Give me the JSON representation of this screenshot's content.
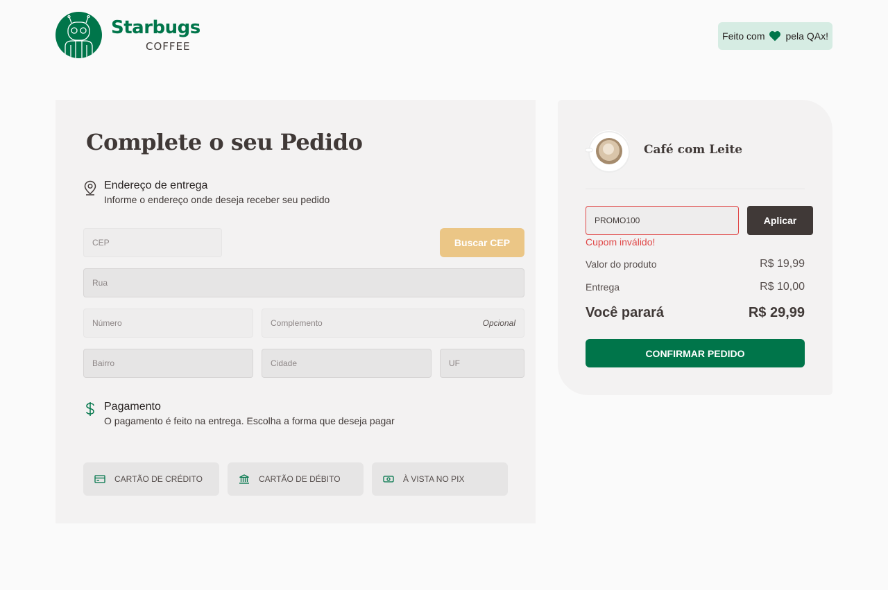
{
  "brand": {
    "name": "Starbugs",
    "subtitle": "COFFEE"
  },
  "badge": {
    "prefix": "Feito com",
    "suffix": "pela QAx!"
  },
  "form": {
    "title": "Complete o seu Pedido",
    "address": {
      "title": "Endereço de entrega",
      "subtitle": "Informe o endereço onde deseja receber seu pedido"
    },
    "fields": {
      "cep": "CEP",
      "rua": "Rua",
      "numero": "Número",
      "complemento": "Complemento",
      "complemento_tag": "Opcional",
      "bairro": "Bairro",
      "cidade": "Cidade",
      "uf": "UF"
    },
    "buscar_cep": "Buscar CEP",
    "payment": {
      "title": "Pagamento",
      "subtitle": "O pagamento é feito na entrega. Escolha a forma que deseja pagar",
      "options": [
        "CARTÃO DE CRÉDITO",
        "CARTÃO DE DÉBITO",
        "À VISTA NO PIX"
      ]
    }
  },
  "cart": {
    "product_name": "Café com Leite",
    "coupon_value": "PROMO100",
    "apply_label": "Aplicar",
    "coupon_error": "Cupom inválido!",
    "rows": [
      {
        "label": "Valor do produto",
        "value": "R$ 19,99"
      },
      {
        "label": "Entrega",
        "value": "R$ 10,00"
      }
    ],
    "total": {
      "label": "Você parará",
      "value": "R$ 29,99"
    },
    "confirm_label": "CONFIRMAR PEDIDO"
  },
  "colors": {
    "brand_green": "#00754a",
    "accent_yellow": "#ebc686",
    "error_red": "#e04848",
    "dark_brown": "#403937"
  }
}
